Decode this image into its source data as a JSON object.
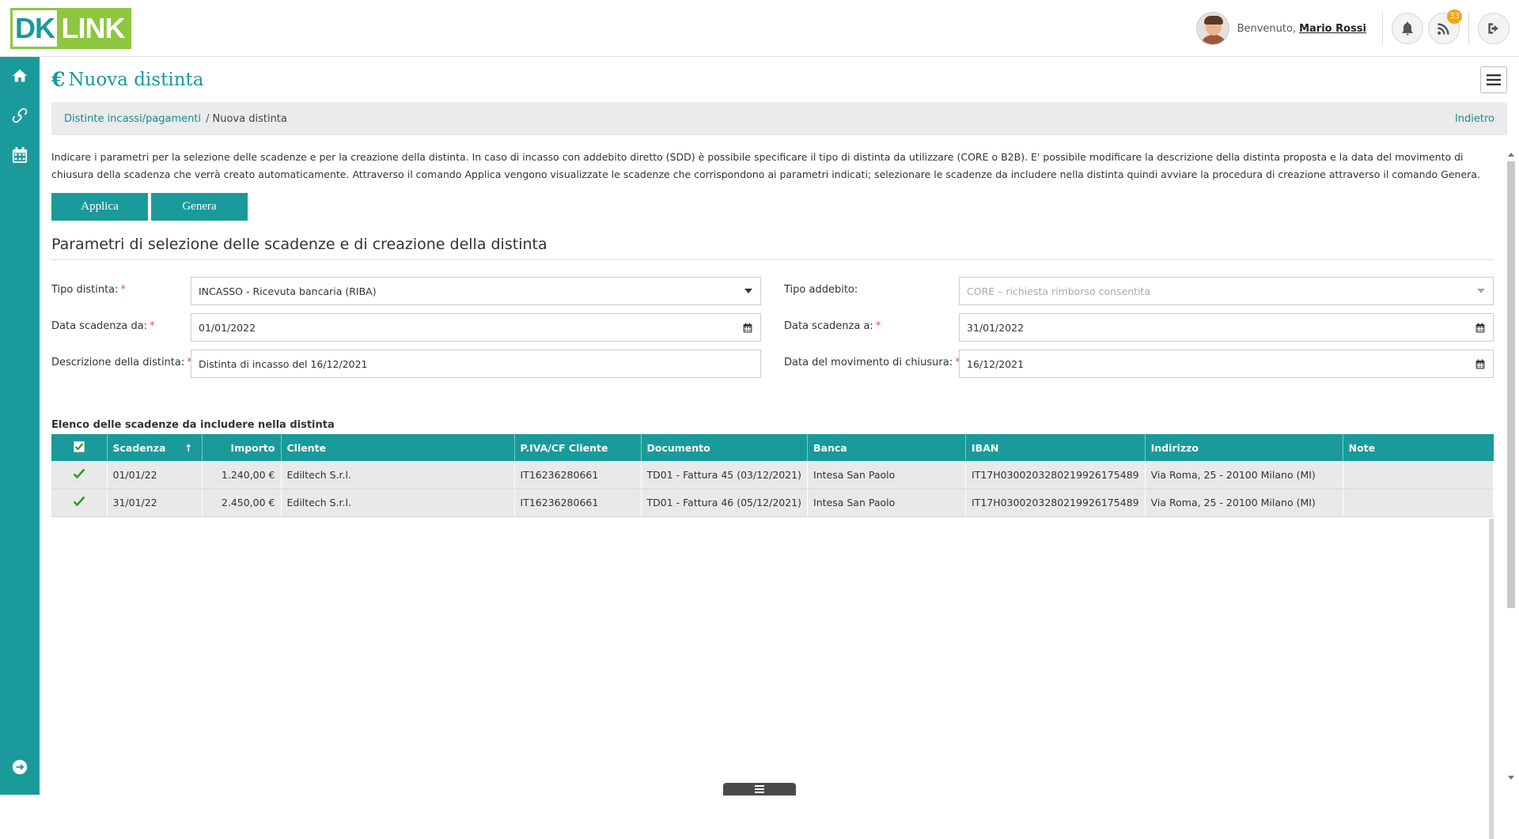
{
  "brand": {
    "logo_left": "DK",
    "logo_right": "LINK"
  },
  "header": {
    "welcome_label": "Benvenuto,",
    "user_name": "Mario Rossi",
    "rss_badge": "33"
  },
  "page": {
    "title": "Nuova distinta",
    "title_symbol": "€"
  },
  "breadcrumb": {
    "parent": "Distinte incassi/pagamenti",
    "separator": "/",
    "current": "Nuova distinta",
    "back": "Indietro"
  },
  "intro_text": "Indicare i parametri per la selezione delle scadenze e per la creazione della distinta. In caso di incasso con addebito diretto (SDD) è possibile specificare il tipo di distinta da utilizzare (CORE o B2B). E' possibile modificare la descrizione della distinta proposta e la data del movimento di chiusura della scadenza che verrà creato automaticamente. Attraverso il comando Applica vengono visualizzate le scadenze che corrispondono ai parametri indicati; selezionare le scadenze da includere nella distinta quindi avviare la procedura di creazione attraverso il comando Genera.",
  "actions": {
    "apply": "Applica",
    "generate": "Genera"
  },
  "section_title": "Parametri di selezione delle scadenze e di creazione della distinta",
  "form": {
    "tipo_distinta_label": "Tipo distinta:",
    "tipo_distinta_value": "INCASSO - Ricevuta bancaria (RIBA)",
    "tipo_addebito_label": "Tipo addebito:",
    "tipo_addebito_value": "CORE – richiesta rimborso consentita",
    "data_da_label": "Data scadenza da:",
    "data_da_value": "01/01/2022",
    "data_a_label": "Data scadenza a:",
    "data_a_value": "31/01/2022",
    "descrizione_label": "Descrizione della distinta:",
    "descrizione_value": "Distinta di incasso del 16/12/2021",
    "data_movimento_label": "Data del movimento di chiusura:",
    "data_movimento_value": "16/12/2021",
    "required_mark": "*"
  },
  "table": {
    "caption": "Elenco delle scadenze da includere nella distinta",
    "sort_arrow": "↑",
    "headers": [
      "Scadenza",
      "Importo",
      "Cliente",
      "P.IVA/CF Cliente",
      "Documento",
      "Banca",
      "IBAN",
      "Indirizzo",
      "Note"
    ],
    "rows": [
      {
        "scadenza": "01/01/22",
        "importo": "1.240,00 €",
        "cliente": "Ediltech S.r.l.",
        "piva": "IT16236280661",
        "documento": "TD01 - Fattura 45 (03/12/2021)",
        "banca": "Intesa San Paolo",
        "iban": "IT17H0300203280219926175489",
        "indirizzo": "Via Roma, 25 - 20100 Milano (MI)",
        "note": ""
      },
      {
        "scadenza": "31/01/22",
        "importo": "2.450,00 €",
        "cliente": "Ediltech S.r.l.",
        "piva": "IT16236280661",
        "documento": "TD01 - Fattura 46 (05/12/2021)",
        "banca": "Intesa San Paolo",
        "iban": "IT17H0300203280219926175489",
        "indirizzo": "Via Roma, 25 - 20100 Milano (MI)",
        "note": ""
      }
    ]
  },
  "colors": {
    "primary": "#1a9a9a",
    "accent": "#8dc63f",
    "badge": "#f2a618",
    "required": "#d9534f"
  },
  "icons": [
    "home-icon",
    "link-icon",
    "calendar-icon",
    "arrow-right-circle-icon",
    "bell-icon",
    "rss-icon",
    "logout-icon",
    "hamburger-icon",
    "caret-down-icon",
    "check-icon"
  ]
}
